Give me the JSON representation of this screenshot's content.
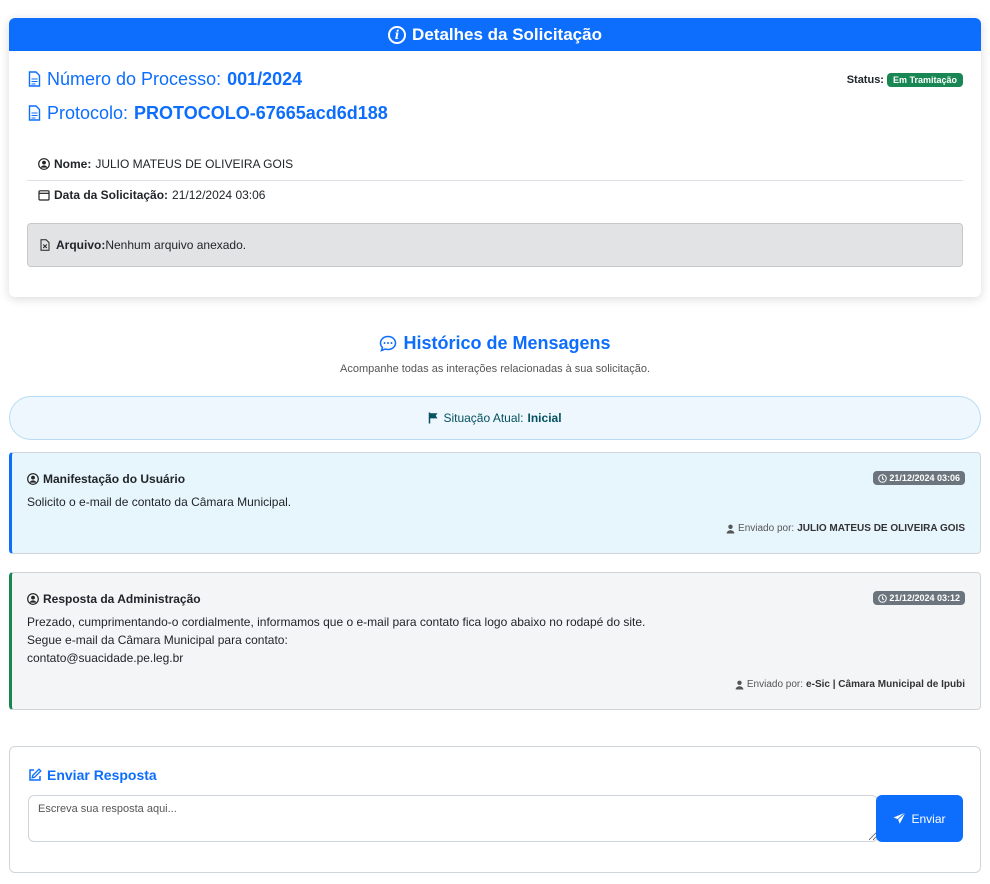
{
  "details": {
    "header": "Detalhes da Solicitação",
    "processo_label": "Número do Processo:",
    "processo_value": "001/2024",
    "protocolo_label": "Protocolo:",
    "protocolo_value": "PROTOCOLO-67665acd6d188",
    "status_label": "Status:",
    "status_value": "Em Tramitação",
    "nome_label": "Nome:",
    "nome_value": "JULIO MATEUS DE OLIVEIRA GOIS",
    "data_label": "Data da Solicitação:",
    "data_value": "21/12/2024 03:06",
    "arquivo_label": "Arquivo:",
    "arquivo_value": "Nenhum arquivo anexado."
  },
  "history": {
    "title": "Histórico de Mensagens",
    "subtitle": "Acompanhe todas as interações relacionadas à sua solicitação.",
    "situacao_label": "Situação Atual:",
    "situacao_value": "Inicial"
  },
  "messages": [
    {
      "title": "Manifestação do Usuário",
      "time": "21/12/2024 03:06",
      "lines": [
        "Solicito o e-mail de contato da Câmara Municipal."
      ],
      "sender_label": "Enviado por:",
      "sender": "JULIO MATEUS DE OLIVEIRA GOIS"
    },
    {
      "title": "Resposta da Administração",
      "time": "21/12/2024 03:12",
      "lines": [
        "Prezado, cumprimentando-o cordialmente, informamos que o e-mail para contato fica logo abaixo no rodapé do site.",
        "Segue e-mail da Câmara Municipal para contato:",
        "contato@suacidade.pe.leg.br"
      ],
      "sender_label": "Enviado por:",
      "sender": "e-Sic | Câmara Municipal de Ipubi"
    }
  ],
  "reply": {
    "title": "Enviar Resposta",
    "placeholder": "Escreva sua resposta aqui...",
    "button": "Enviar"
  },
  "colors": {
    "primary": "#0d6efd",
    "success": "#198754",
    "secondary": "#6c757d"
  }
}
